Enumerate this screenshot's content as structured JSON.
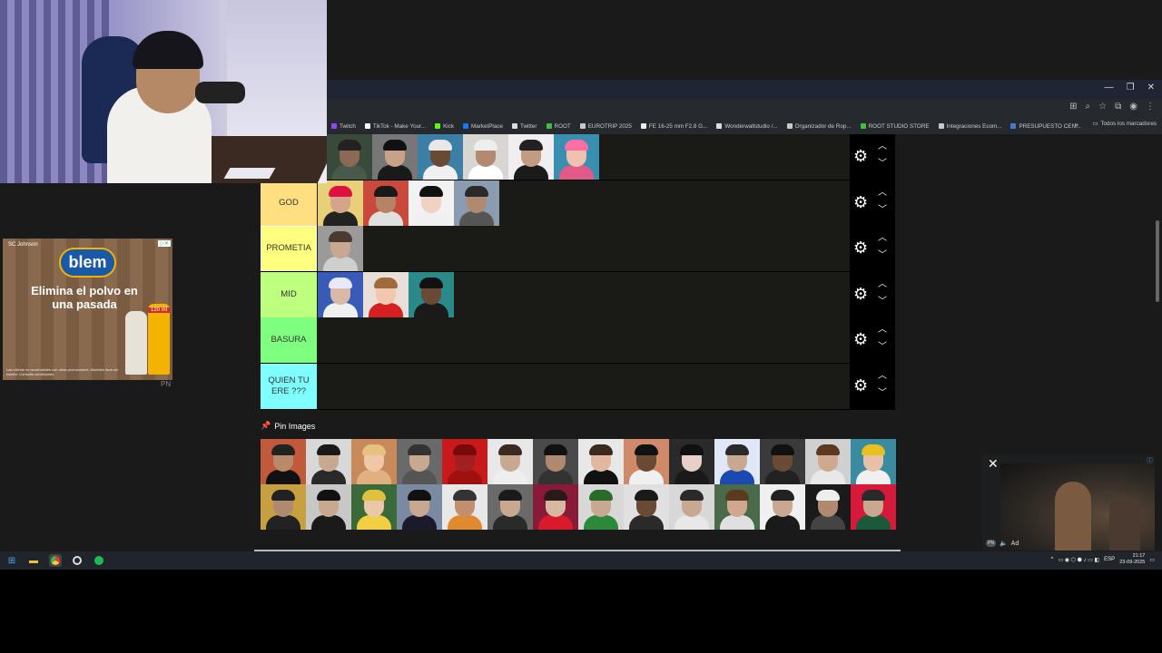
{
  "browser": {
    "window_controls": [
      "—",
      "❐",
      "✕"
    ],
    "bookmarks": [
      {
        "label": "Twitch",
        "color": "#9146ff"
      },
      {
        "label": "TikTok - Make Your...",
        "color": "#ffffff"
      },
      {
        "label": "Kick",
        "color": "#53fc18"
      },
      {
        "label": "MarketPlace",
        "color": "#1877f2"
      },
      {
        "label": "Twitter",
        "color": "#dddddd"
      },
      {
        "label": "ROOT",
        "color": "#3fbf3f"
      },
      {
        "label": "EUROTRIP 2025",
        "color": "#c9c9c9"
      },
      {
        "label": "FE 16-25 mm F2.8 G...",
        "color": "#eeeeee"
      },
      {
        "label": "Wonderwallstudio /...",
        "color": "#dddddd"
      },
      {
        "label": "Organizador de Rop...",
        "color": "#c9c9c9"
      },
      {
        "label": "ROOT STUDIO STORE",
        "color": "#3fbf3f"
      },
      {
        "label": "Integraciones Ecom...",
        "color": "#c9c9c9"
      },
      {
        "label": "PRESUPUESTO CEN...",
        "color": "#4a78d0"
      }
    ],
    "bookmarks_more": "»",
    "all_bookmarks": "Todos los marcadores"
  },
  "tiers": [
    {
      "label": "",
      "color": "#ffffff",
      "items": [
        {
          "bg": "#3a4a3a",
          "skin": "#8a6a55",
          "hair": "#222",
          "shirt": "#4a5a4a"
        },
        {
          "bg": "#777777",
          "skin": "#c9a08a",
          "hair": "#111",
          "shirt": "#1a1a1a"
        },
        {
          "bg": "#3b7fa6",
          "skin": "#6b4a35",
          "hair": "#e8e8e8",
          "shirt": "#f0f0f0"
        },
        {
          "bg": "#d8d6d2",
          "skin": "#b38a70",
          "hair": "#eeeeee",
          "shirt": "#ffffff"
        },
        {
          "bg": "#f0eeee",
          "skin": "#c29c80",
          "hair": "#222",
          "shirt": "#1a1a1a"
        },
        {
          "bg": "#3a8fb0",
          "skin": "#f0c0b0",
          "hair": "#ff6fa5",
          "shirt": "#e05a8a"
        }
      ]
    },
    {
      "label": "GOD",
      "color": "#ffdf7f",
      "items": [
        {
          "bg": "#e8d07a",
          "skin": "#d4a58a",
          "hair": "#e01040",
          "shirt": "#222"
        },
        {
          "bg": "#c94a3a",
          "skin": "#b58366",
          "hair": "#1a1a1a",
          "shirt": "#e0e0e0"
        },
        {
          "bg": "#f2f2f2",
          "skin": "#efd2c4",
          "hair": "#111",
          "shirt": "#f0f0f0"
        },
        {
          "bg": "#8b9bb0",
          "skin": "#b08a70",
          "hair": "#2a2a2a",
          "shirt": "#555"
        }
      ]
    },
    {
      "label": "PROMETIA",
      "color": "#ffff7f",
      "items": [
        {
          "bg": "#9a9a9a",
          "skin": "#c8a890",
          "hair": "#4a3a30",
          "shirt": "#cfcfcf"
        }
      ]
    },
    {
      "label": "MID",
      "color": "#bfff7f",
      "items": [
        {
          "bg": "#3a5ab8",
          "skin": "#d9b8a5",
          "hair": "#e8e8ff",
          "shirt": "#f0f0f0"
        },
        {
          "bg": "#e8e0d8",
          "skin": "#f0c8b0",
          "hair": "#a06a3a",
          "shirt": "#d42020"
        },
        {
          "bg": "#2a8a8a",
          "skin": "#6b4a35",
          "hair": "#111",
          "shirt": "#1a1a1a"
        }
      ]
    },
    {
      "label": "BASURA",
      "color": "#7fff7f",
      "items": []
    },
    {
      "label": "QUIEN TU ERE ???",
      "color": "#7fffff",
      "items": []
    }
  ],
  "pin": {
    "icon": "📌",
    "label": "Pin Images"
  },
  "pool": [
    {
      "bg": "#c05a3a",
      "skin": "#b88a6a",
      "hair": "#222",
      "shirt": "#111"
    },
    {
      "bg": "#d8d8d8",
      "skin": "#c8a890",
      "hair": "#1a1a1a",
      "shirt": "#2a2a2a"
    },
    {
      "bg": "#c88a5a",
      "skin": "#f0c8a8",
      "hair": "#e8c080",
      "shirt": "#e0b080"
    },
    {
      "bg": "#6a6a6a",
      "skin": "#c8a890",
      "hair": "#333",
      "shirt": "#555"
    },
    {
      "bg": "#c81a1a",
      "skin": "#a02020",
      "hair": "#7a0a0a",
      "shirt": "#a01010"
    },
    {
      "bg": "#e8e8e8",
      "skin": "#c8a890",
      "hair": "#3a2a20",
      "shirt": "#eeeeee"
    },
    {
      "bg": "#4a4a4a",
      "skin": "#b08a70",
      "hair": "#111",
      "shirt": "#333"
    },
    {
      "bg": "#e8e8e8",
      "skin": "#e0b8a0",
      "hair": "#3a2a20",
      "shirt": "#111"
    },
    {
      "bg": "#d08a6a",
      "skin": "#6b4a35",
      "hair": "#111",
      "shirt": "#f0f0f0"
    },
    {
      "bg": "#2a2a2a",
      "skin": "#e8d0c8",
      "hair": "#111",
      "shirt": "#1a1a1a"
    },
    {
      "bg": "#e0e8f8",
      "skin": "#c8a890",
      "hair": "#2a2a2a",
      "shirt": "#1a4ab0"
    },
    {
      "bg": "#3a3a3a",
      "skin": "#6b4a35",
      "hair": "#111",
      "shirt": "#222"
    },
    {
      "bg": "#d0d0d0",
      "skin": "#d0a890",
      "hair": "#5a3a20",
      "shirt": "#e8e8e8"
    },
    {
      "bg": "#3a8aa0",
      "skin": "#e8c0a8",
      "hair": "#e8c020",
      "shirt": "#f0f0f0"
    },
    {
      "bg": "#c8a040",
      "skin": "#b08a70",
      "hair": "#222",
      "shirt": "#222"
    },
    {
      "bg": "#c8c8c8",
      "skin": "#c8a890",
      "hair": "#111",
      "shirt": "#1a1a1a"
    },
    {
      "bg": "#3a6a3a",
      "skin": "#e8c8a8",
      "hair": "#e0c040",
      "shirt": "#f0d040"
    },
    {
      "bg": "#7a8aa0",
      "skin": "#c8a890",
      "hair": "#111",
      "shirt": "#1a1a2a"
    },
    {
      "bg": "#e8e8e8",
      "skin": "#c09070",
      "hair": "#333",
      "shirt": "#e08a30"
    },
    {
      "bg": "#6a6a6a",
      "skin": "#c8a890",
      "hair": "#1a1a1a",
      "shirt": "#2a2a2a"
    },
    {
      "bg": "#8a1a3a",
      "skin": "#d8b8a0",
      "hair": "#2a1a1a",
      "shirt": "#d81a2a"
    },
    {
      "bg": "#d8d8d8",
      "skin": "#c8a890",
      "hair": "#2a6a2a",
      "shirt": "#2a8a3a"
    },
    {
      "bg": "#e0e0e0",
      "skin": "#6b4a35",
      "hair": "#1a1a1a",
      "shirt": "#2a2a2a"
    },
    {
      "bg": "#d8d8d8",
      "skin": "#c8a890",
      "hair": "#2a2a2a",
      "shirt": "#e8e8e8"
    },
    {
      "bg": "#4a6a4a",
      "skin": "#d0a890",
      "hair": "#5a3a20",
      "shirt": "#e0e0e0"
    },
    {
      "bg": "#f0f0f0",
      "skin": "#c8a890",
      "hair": "#222",
      "shirt": "#1a1a1a"
    },
    {
      "bg": "#1a1a1a",
      "skin": "#b08a70",
      "hair": "#eeeeee",
      "shirt": "#444"
    },
    {
      "bg": "#d81a3a",
      "skin": "#c8a890",
      "hair": "#2a2a2a",
      "shirt": "#1a5a3a"
    }
  ],
  "ad_left": {
    "brand_top": "SC Johnson",
    "logo": "blem",
    "tagline": "Elimina el polvo en una pasada",
    "badge": "120 ml",
    "fine_print": "Las ofertas no acumulables con otras promociones. Muebles lisos sin estaño. Consulte condiciones.",
    "watermark": "PN"
  },
  "ad_right": {
    "close": "✕",
    "info": "ⓘ",
    "label": "Ad",
    "pn": "PN"
  },
  "taskbar": {
    "lang": "ESP",
    "time": "21:17",
    "date": "23-09-2025"
  }
}
